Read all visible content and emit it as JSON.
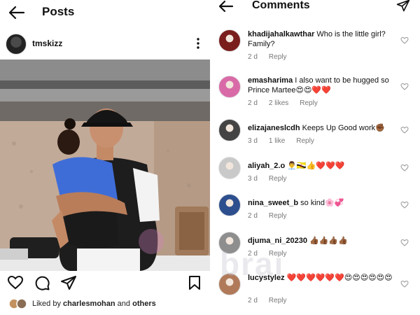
{
  "post_screen": {
    "title": "Posts",
    "author": {
      "username": "tmskizz"
    },
    "actions": {
      "like_icon": "heart-outline-icon",
      "comment_icon": "comment-bubble-icon",
      "share_icon": "paper-plane-icon",
      "save_icon": "bookmark-icon"
    },
    "likes": {
      "prefix": "Liked by ",
      "user": "charlesmohan",
      "middle": " and ",
      "others": "others"
    }
  },
  "comments_screen": {
    "title": "Comments",
    "send_icon": "paper-plane-icon",
    "reply_label": "Reply",
    "comments": [
      {
        "username": "khadijahalkawthar",
        "text": "Who is the little girl? Family?",
        "age": "2 d",
        "likes": "",
        "avatar_color": "#7a1d1d"
      },
      {
        "username": "emasharima",
        "text": "I also want to be hugged so Prince Martee😍😍❤️❤️",
        "age": "2 d",
        "likes": "2 likes",
        "avatar_color": "#d96aa8"
      },
      {
        "username": "elizajaneslcdh",
        "text": "Keeps Up Good work✊🏾",
        "age": "3 d",
        "likes": "1 like",
        "avatar_color": "#444444"
      },
      {
        "username": "aliyah_2.o",
        "text": "👨‍💼🇧🇳👍❤️❤️❤️",
        "age": "3 d",
        "likes": "",
        "avatar_color": "#c9c9c9"
      },
      {
        "username": "nina_sweet_b",
        "text": "so kind🌸💞",
        "age": "2 d",
        "likes": "",
        "avatar_color": "#2d4f8e"
      },
      {
        "username": "djuma_ni_20230",
        "text": "👍🏾👍🏾👍🏾👍🏾",
        "age": "2 d",
        "likes": "",
        "avatar_color": "#8e8e8e"
      },
      {
        "username": "lucystylez",
        "text": "❤️❤️❤️❤️❤️❤️😍😍😍😍😍😍",
        "age": "2 d",
        "likes": "",
        "avatar_color": "#b07a5a"
      }
    ]
  },
  "watermark": "brai"
}
